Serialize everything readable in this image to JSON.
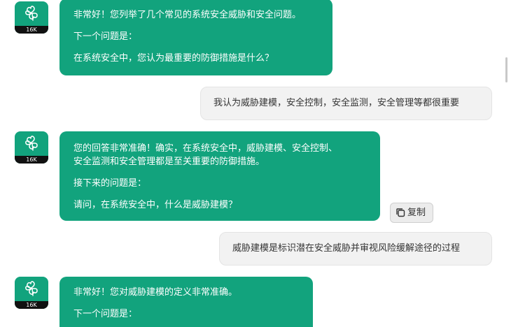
{
  "avatar": {
    "label": "16K",
    "icon": "clover-logo-icon",
    "color": "#12a37d"
  },
  "messages": [
    {
      "role": "assistant",
      "lines": [
        "非常好！您列举了几个常见的系统安全威胁和安全问题。",
        "下一个问题是：",
        "在系统安全中，您认为最重要的防御措施是什么？"
      ]
    },
    {
      "role": "user",
      "text": "我认为威胁建模，安全控制，安全监测，安全管理等都很重要"
    },
    {
      "role": "assistant",
      "lines": [
        "您的回答非常准确！确实，在系统安全中，威胁建模、安全控制、",
        "安全监测和安全管理都是至关重要的防御措施。",
        "接下来的问题是：",
        "请问，在系统安全中，什么是威胁建模？"
      ],
      "copy_label": "复制"
    },
    {
      "role": "user",
      "text": "威胁建模是标识潜在安全威胁并审视风险缓解途径的过程"
    },
    {
      "role": "assistant",
      "lines": [
        "非常好！您对威胁建模的定义非常准确。",
        "下一个问题是："
      ]
    }
  ]
}
